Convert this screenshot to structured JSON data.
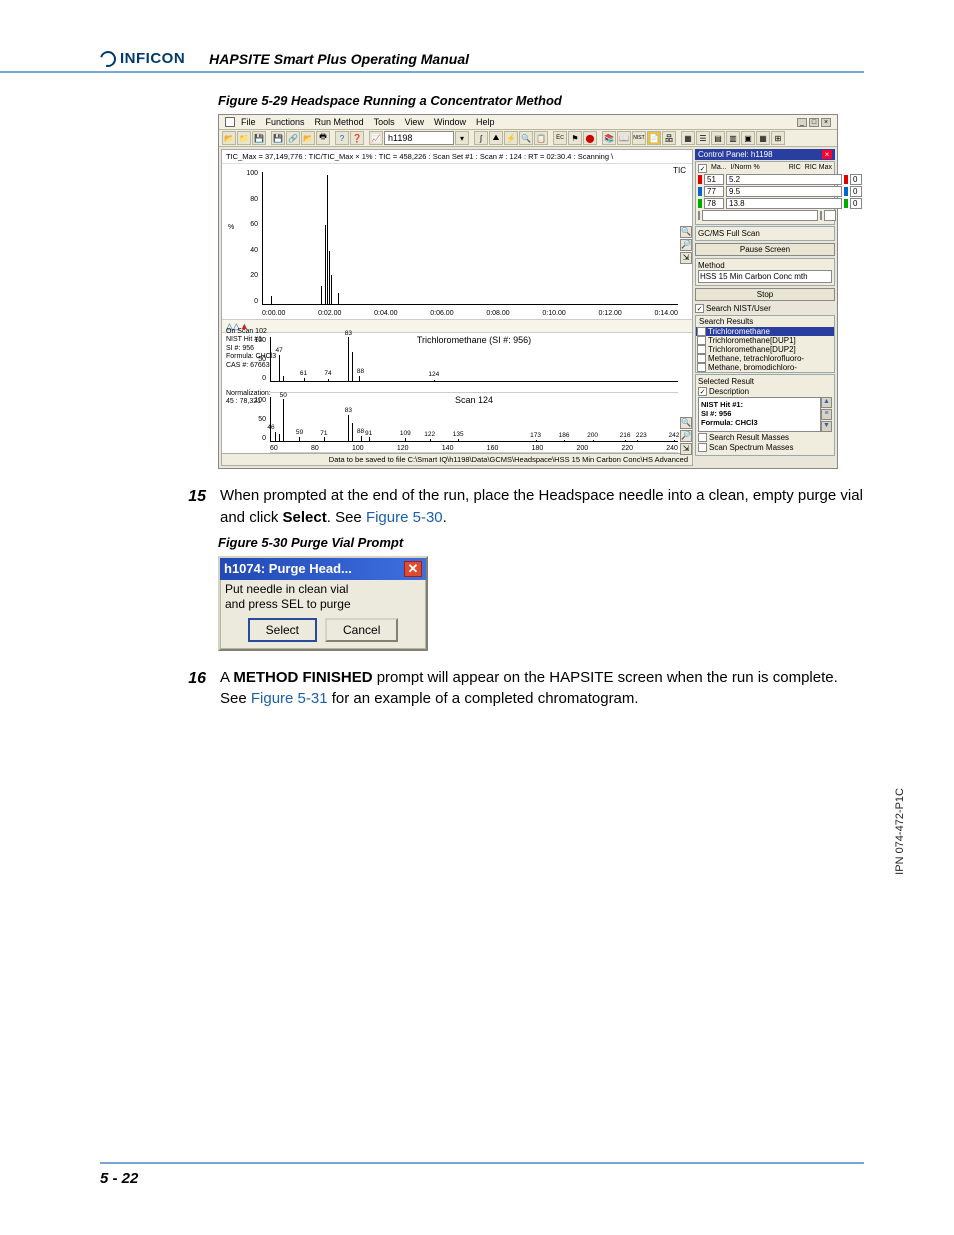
{
  "header": {
    "logo_text": "INFICON",
    "doc_title": "HAPSITE Smart Plus Operating Manual"
  },
  "figure29": {
    "caption": "Figure 5-29  Headspace Running a Concentrator Method"
  },
  "app": {
    "menu": {
      "file": "File",
      "functions": "Functions",
      "runmethod": "Run Method",
      "tools": "Tools",
      "view": "View",
      "window": "Window",
      "help": "Help"
    },
    "toolbar": {
      "filename": "h1198"
    },
    "chart_header": "TIC_Max = 37,149,776 : TIC/TIC_Max × 1% : TIC = 458,226 : Scan Set #1 : Scan # : 124 : RT = 02:30.4 : Scanning \\",
    "tic_label": "TIC",
    "mid_chart_title": "Trichloromethane (SI #: 956)",
    "bottom_chart_title": "Scan 124",
    "info": {
      "onscan": "On Scan 102",
      "nist": "NIST Hit #1:",
      "si": "SI #: 956",
      "formula": "Formula: CHCl3",
      "cas": "CAS #: 67663",
      "norm": "Normalization:",
      "normval": "45 : 78,321"
    },
    "status": "Data to be saved to file C:\\Smart IQ\\h1198\\Data\\GCMS\\Headspace\\HSS 15 Min Carbon Conc\\HS Advanced"
  },
  "chart_data": {
    "top_chromatogram": {
      "type": "line",
      "ylabel": "%",
      "y_ticks": [
        100,
        80,
        60,
        40,
        20,
        0
      ],
      "x_ticks": [
        "0:00.00",
        "0:02.00",
        "0:04.00",
        "0:06.00",
        "0:08.00",
        "0:10.00",
        "0:12.00",
        "0:14.00"
      ],
      "peaks_rt_pct": [
        {
          "rt": "0:02.30",
          "height": 98
        },
        {
          "rt": "0:02.50",
          "height": 22
        },
        {
          "rt": "0:02.10",
          "height": 14
        },
        {
          "rt": "0:02.70",
          "height": 8
        },
        {
          "rt": "0:00.30",
          "height": 6
        }
      ]
    },
    "library_spectrum": {
      "type": "bar",
      "title": "Trichloromethane (SI #: 956)",
      "y_ticks": [
        100,
        50,
        0
      ],
      "peaks": [
        {
          "mz": 47,
          "intensity": 60
        },
        {
          "mz": 48,
          "intensity": 12
        },
        {
          "mz": 49,
          "intensity": 8
        },
        {
          "mz": 58,
          "intensity": 4
        },
        {
          "mz": 59,
          "intensity": 4
        },
        {
          "mz": 61,
          "intensity": 6
        },
        {
          "mz": 74,
          "intensity": 5
        },
        {
          "mz": 83,
          "intensity": 100
        },
        {
          "mz": 85,
          "intensity": 65
        },
        {
          "mz": 87,
          "intensity": 12
        },
        {
          "mz": 88,
          "intensity": 6
        },
        {
          "mz": 124,
          "intensity": 3
        }
      ]
    },
    "scan_spectrum": {
      "type": "bar",
      "title": "Scan 124",
      "y_ticks": [
        100,
        50,
        0
      ],
      "x_ticks": [
        60,
        80,
        100,
        120,
        140,
        160,
        180,
        200,
        220,
        240
      ],
      "peaks": [
        {
          "mz": 46,
          "intensity": 20
        },
        {
          "mz": 48,
          "intensity": 15
        },
        {
          "mz": 50,
          "intensity": 95
        },
        {
          "mz": 55,
          "intensity": 8
        },
        {
          "mz": 59,
          "intensity": 10
        },
        {
          "mz": 71,
          "intensity": 8
        },
        {
          "mz": 83,
          "intensity": 60
        },
        {
          "mz": 85,
          "intensity": 40
        },
        {
          "mz": 88,
          "intensity": 12
        },
        {
          "mz": 91,
          "intensity": 8
        },
        {
          "mz": 109,
          "intensity": 6
        },
        {
          "mz": 122,
          "intensity": 5
        },
        {
          "mz": 135,
          "intensity": 4
        },
        {
          "mz": 173,
          "intensity": 3
        },
        {
          "mz": 186,
          "intensity": 3
        },
        {
          "mz": 200,
          "intensity": 3
        },
        {
          "mz": 216,
          "intensity": 3
        },
        {
          "mz": 223,
          "intensity": 3
        },
        {
          "mz": 242,
          "intensity": 3
        }
      ]
    }
  },
  "panel": {
    "title": "Control Panel: h1198",
    "hdr": {
      "c1": "Ma...",
      "c2": "I/Norm %",
      "c3": "RIC",
      "c4": "RIC Max"
    },
    "rows": [
      {
        "color": "#d00",
        "mass": "51",
        "norm": "5.2",
        "ric": "0"
      },
      {
        "color": "#06c",
        "mass": "77",
        "norm": "9.5",
        "ric": "0"
      },
      {
        "color": "#0a0",
        "mass": "78",
        "norm": "13.8",
        "ric": "0"
      }
    ],
    "mode_label": "GC/MS Full Scan",
    "pause_btn": "Pause Screen",
    "method_group": "Method",
    "method_text": "HSS 15 Min Carbon Conc mth",
    "stop_btn": "Stop",
    "search_check": "Search NIST/User",
    "results_label": "Search Results",
    "results": [
      {
        "sel": true,
        "label": "Trichloromethane"
      },
      {
        "sel": false,
        "label": "Trichloromethane[DUP1]"
      },
      {
        "sel": false,
        "label": "Trichloromethane[DUP2]"
      },
      {
        "sel": false,
        "label": "Methane, tetrachlorofluoro-"
      },
      {
        "sel": false,
        "label": "Methane, bromodichloro-"
      }
    ],
    "selected_label": "Selected Result",
    "desc_check": "Description",
    "desc_text": "NIST Hit #1:\nSI #: 956\nFormula: CHCl3",
    "sr_masses": "Search Result Masses",
    "ss_masses": "Scan Spectrum Masses"
  },
  "step15": {
    "num": "15",
    "text_a": "When prompted at the end of the run, place the Headspace needle into a clean, empty purge vial and click ",
    "bold": "Select",
    "text_b": ". See ",
    "link": "Figure 5-30",
    "text_c": "."
  },
  "figure30": {
    "caption": "Figure 5-30  Purge Vial Prompt"
  },
  "dialog": {
    "title": "h1074: Purge Head...",
    "body1": "Put needle in clean vial",
    "body2": "and press SEL to purge",
    "btn_select": "Select",
    "btn_cancel": "Cancel"
  },
  "step16": {
    "num": "16",
    "text_a": "A ",
    "bold": "METHOD FINISHED",
    "text_b": " prompt will appear on the HAPSITE screen when the run is complete. See ",
    "link": "Figure 5-31",
    "text_c": " for an example of a completed chromatogram."
  },
  "footer": {
    "page": "5 - 22"
  },
  "side": {
    "label": "IPN 074-472-P1C"
  }
}
